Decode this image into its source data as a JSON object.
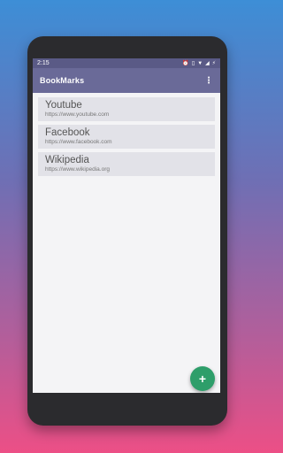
{
  "status": {
    "time": "2:15",
    "icons": [
      "alarm-icon",
      "vibrate-icon",
      "wifi-icon",
      "signal-icon",
      "battery-charging-icon"
    ]
  },
  "appbar": {
    "title": "BookMarks",
    "menu_icon": "more-vert-icon"
  },
  "bookmarks": [
    {
      "title": "Youtube",
      "url": "https://www.youtube.com"
    },
    {
      "title": "Facebook",
      "url": "https://www.facebook.com"
    },
    {
      "title": "Wikipedia",
      "url": "https://www.wikipedia.org"
    }
  ],
  "fab": {
    "icon": "add-icon",
    "glyph": "+"
  },
  "colors": {
    "toolbar": "#6a6a98",
    "status_bar": "#5a5a86",
    "fab": "#2e9e6a",
    "card": "#e2e2e8"
  }
}
